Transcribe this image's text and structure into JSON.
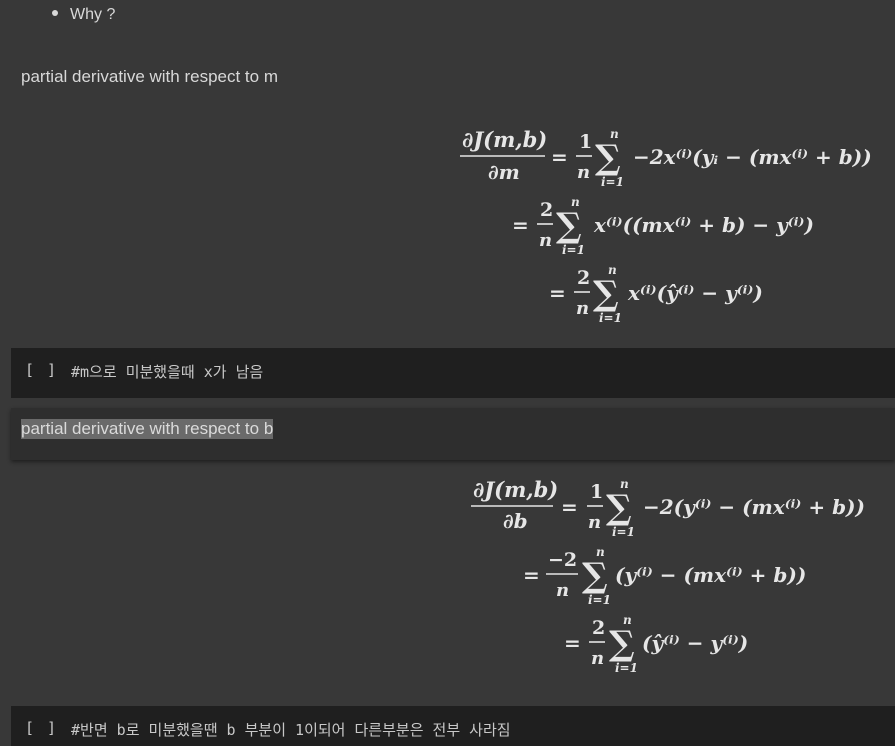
{
  "bullet": {
    "text": "Why ?"
  },
  "paragraphs": {
    "m_heading": "partial derivative with respect to m",
    "b_heading": "partial derivative with respect to b"
  },
  "cells": [
    {
      "brackets": "[ ]",
      "code": "#m으로 미분했을때 x가 남음"
    },
    {
      "brackets": "[ ]",
      "code": "#반면 b로 미분했을땐 b 부분이 1이되어 다른부분은 전부 사라짐"
    }
  ],
  "equations": {
    "m": {
      "lhs_num": "∂J(m,b)",
      "lhs_den": "∂m",
      "line1": "−2x⁽ⁱ⁾(yᵢ − (mx⁽ⁱ⁾ + b))",
      "line2": "x⁽ⁱ⁾((mx⁽ⁱ⁾ + b) − y⁽ⁱ⁾)",
      "line3": "x⁽ⁱ⁾(ŷ⁽ⁱ⁾ − y⁽ⁱ⁾)"
    },
    "b": {
      "lhs_num": "∂J(m,b)",
      "lhs_den": "∂b",
      "line1": "−2(y⁽ⁱ⁾ − (mx⁽ⁱ⁾ + b))",
      "line2": "(y⁽ⁱ⁾ − (mx⁽ⁱ⁾ + b))",
      "line3": "(ŷ⁽ⁱ⁾ − y⁽ⁱ⁾)"
    },
    "symbols": {
      "equals": "=",
      "sum": "∑",
      "upper": "n",
      "lower": "i=1",
      "one": "1",
      "two": "2",
      "neg_two": "−2",
      "n": "n"
    }
  },
  "colors": {
    "background": "#383838",
    "code_cell": "#1f1f1f",
    "text": "#d5d5d5",
    "selection": "#6a6a6a"
  }
}
